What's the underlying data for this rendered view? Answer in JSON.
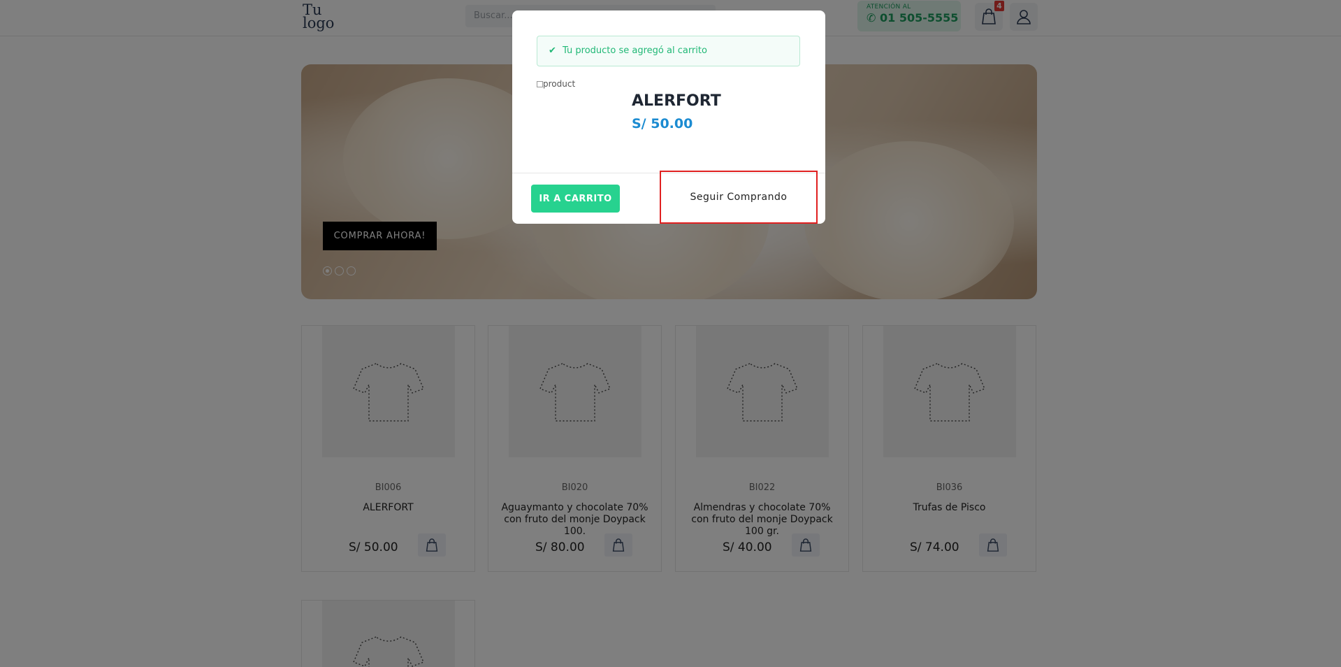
{
  "header": {
    "logo_line1": "Tu",
    "logo_line2": "logo",
    "search_placeholder": "Buscar...",
    "attention_label": "ATENCIÓN AL",
    "phone": "01 505-5555",
    "cart_count": "4"
  },
  "hero": {
    "buy_label": "COMPRAR AHORA!",
    "slides": 3,
    "active_slide": 1
  },
  "products": [
    {
      "code": "BI006",
      "name": "ALERFORT",
      "price": "S/ 50.00"
    },
    {
      "code": "BI020",
      "name": "Aguaymanto y chocolate 70% con fruto del monje Doypack 100.",
      "price": "S/ 80.00"
    },
    {
      "code": "BI022",
      "name": "Almendras y chocolate 70% con fruto del monje Doypack 100 gr.",
      "price": "S/ 40.00"
    },
    {
      "code": "BI036",
      "name": "Trufas de Pisco",
      "price": "S/ 74.00"
    }
  ],
  "modal": {
    "alert": "Tu producto se agregó al carrito",
    "image_alt": "product",
    "product_name": "ALERFORT",
    "product_price": "S/ 50.00",
    "go_cart_label": "IR A CARRITO",
    "keep_shopping_label": "Seguir Comprando"
  },
  "colors": {
    "accent_green": "#27d28f",
    "price_blue": "#1b8bd1",
    "badge_red": "#e53935",
    "highlight_red": "#e02020"
  }
}
